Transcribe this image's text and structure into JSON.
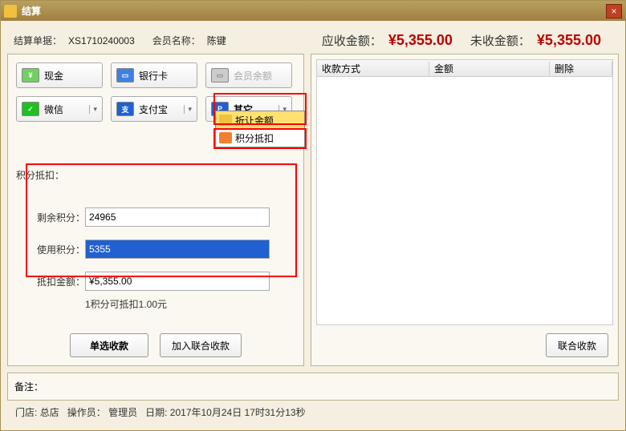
{
  "window": {
    "title": "结算"
  },
  "header": {
    "order_label": "结算单据：",
    "order_value": "XS1710240003",
    "member_label": "会员名称：",
    "member_value": "陈键",
    "due_label": "应收金额：",
    "due_value": "¥5,355.00",
    "unpaid_label": "未收金额：",
    "unpaid_value": "¥5,355.00"
  },
  "payments": {
    "cash": "现金",
    "card": "银行卡",
    "balance": "会员余额",
    "wechat": "微信",
    "alipay": "支付宝",
    "other": "其它"
  },
  "dropdown": {
    "discount": "折让金额",
    "points": "积分抵扣"
  },
  "points_section": {
    "title": "积分抵扣：",
    "remain_label": "剩余积分：",
    "remain_value": "24965",
    "use_label": "使用积分：",
    "use_value": "5355",
    "deduct_label": "抵扣金额：",
    "deduct_value": "¥5,355.00",
    "hint": "1积分可抵扣1.00元"
  },
  "actions": {
    "single": "单选收款",
    "joint": "加入联合收款",
    "combined": "联合收款"
  },
  "table": {
    "col1": "收款方式",
    "col2": "金额",
    "col3": "删除"
  },
  "remark": {
    "label": "备注："
  },
  "status": {
    "store_label": "门店:",
    "store_value": "总店",
    "operator_label": "操作员：",
    "operator_value": "管理员",
    "date_label": "日期:",
    "date_value": "2017年10月24日 17时31分13秒"
  }
}
